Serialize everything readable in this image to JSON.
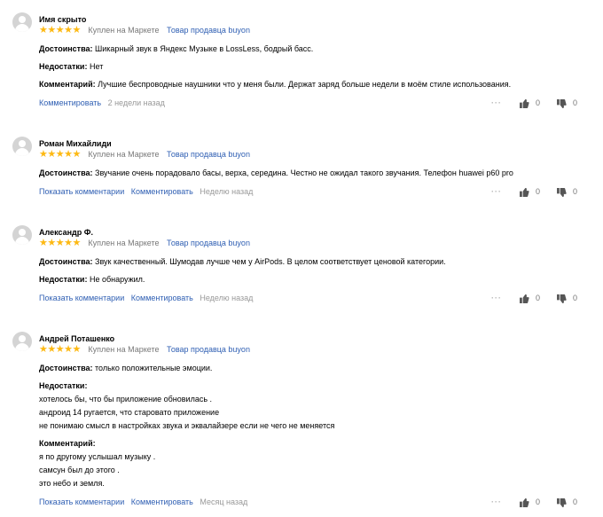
{
  "common": {
    "bought_label": "Куплен на Маркете",
    "seller_label": "Товар продавца buyon",
    "pros_label": "Достоинства:",
    "cons_label": "Недостатки:",
    "comment_label": "Комментарий:",
    "comment_action": "Комментировать",
    "show_comments": "Показать комментарии"
  },
  "reviews": [
    {
      "name": "Имя скрыто",
      "rating": 5,
      "pros": "Шикарный звук в Яндекс Музыке в LossLess, бодрый басс.",
      "cons": "Нет",
      "comment": "Лучшие беспроводные наушники что у меня были. Держат заряд больше недели в моём стиле использования.",
      "date": "2 недели назад",
      "likes": "0",
      "dislikes": "0"
    },
    {
      "name": "Роман Михайлиди",
      "rating": 5,
      "pros": "Звучание очень порадовало басы, верха, середина. Честно не ожидал такого звучания. Телефон huawei p60 pro",
      "date": "Неделю назад",
      "likes": "0",
      "dislikes": "0"
    },
    {
      "name": "Александр Ф.",
      "rating": 5,
      "pros": "Звук качественный. Шумодав лучше чем у AirPods. В целом соответствует ценовой категории.",
      "cons": "Не обнаружил.",
      "date": "Неделю назад",
      "likes": "0",
      "dislikes": "0"
    },
    {
      "name": "Андрей Поташенко",
      "rating": 5,
      "pros": "только положительные эмоции.",
      "cons_lines": [
        "хотелось бы, что бы приложение обновилась .",
        "андроид 14 ругается, что старовато приложение",
        "не понимаю смысл в настройках звука и эквалайзере если не чего не меняется"
      ],
      "comment_lines": [
        "я по другому услышал музыку .",
        "самсун был до этого .",
        "это небо и земля."
      ],
      "date": "Месяц назад",
      "likes": "0",
      "dislikes": "0"
    }
  ]
}
